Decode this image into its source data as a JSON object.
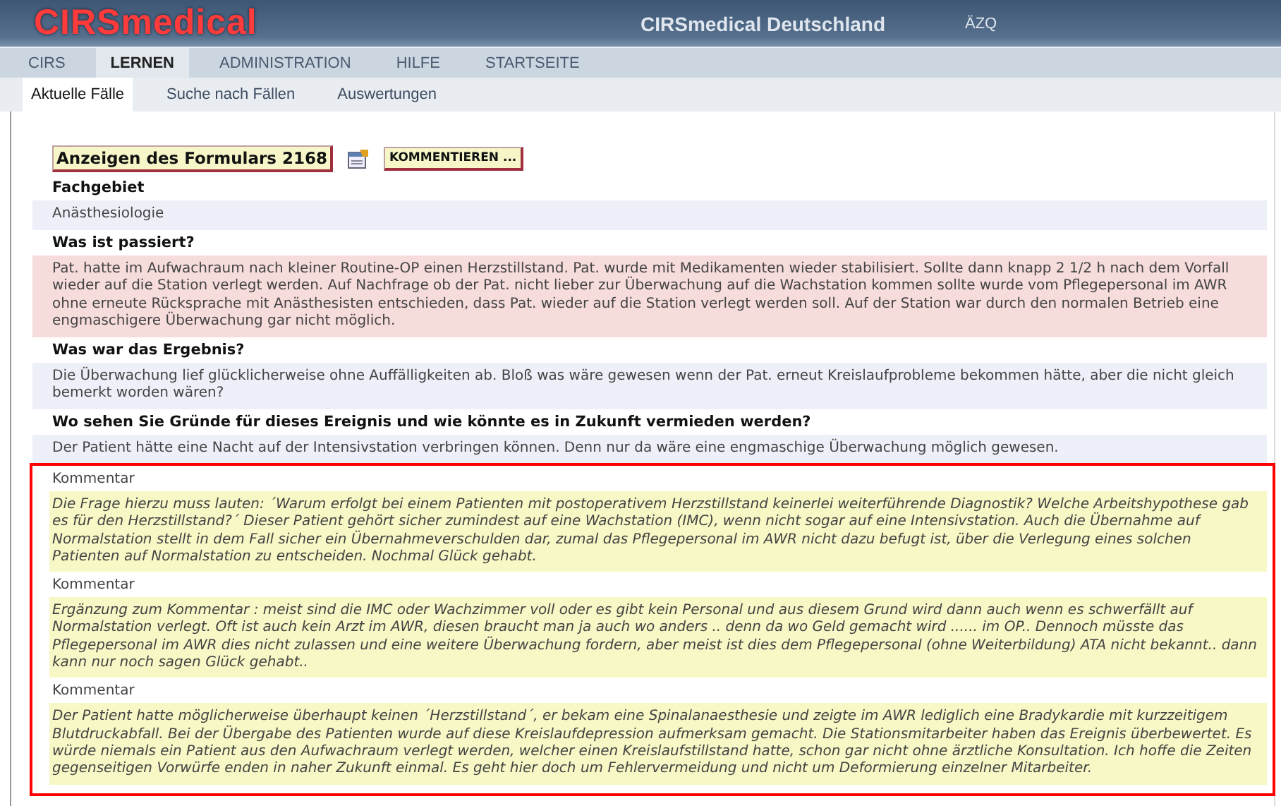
{
  "header": {
    "logo": "CIRSmedical",
    "title": "CIRSmedical Deutschland",
    "org": "ÄZQ"
  },
  "nav": [
    {
      "label": "CIRS",
      "selected": false
    },
    {
      "label": "LERNEN",
      "selected": true
    },
    {
      "label": "ADMINISTRATION",
      "selected": false
    },
    {
      "label": "HILFE",
      "selected": false
    },
    {
      "label": "STARTSEITE",
      "selected": false
    }
  ],
  "subnav": [
    {
      "label": "Aktuelle Fälle",
      "selected": true
    },
    {
      "label": "Suche nach Fällen",
      "selected": false
    },
    {
      "label": "Auswertungen",
      "selected": false
    }
  ],
  "form_button": "Anzeigen des Formulars 2168",
  "comment_button": "KOMMENTIEREN ...",
  "sections": [
    {
      "label": "Fachgebiet",
      "value": "Anästhesiologie",
      "flagged": false
    },
    {
      "label": "Was ist passiert?",
      "value": "Pat. hatte im Aufwachraum nach kleiner Routine-OP einen Herzstillstand. Pat. wurde mit Medikamenten wieder stabilisiert. Sollte dann knapp 2 1/2 h nach dem Vorfall wieder auf die Station verlegt werden. Auf Nachfrage ob der Pat. nicht lieber zur Überwachung auf die Wachstation kommen sollte wurde vom Pflegepersonal im AWR ohne erneute Rücksprache mit Anästhesisten entschieden, dass Pat. wieder auf die Station verlegt werden soll. Auf der Station war durch den normalen Betrieb eine engmaschigere Überwachung gar nicht möglich.",
      "flagged": true
    },
    {
      "label": "Was war das Ergebnis?",
      "value": "Die Überwachung lief glücklicherweise ohne Auffälligkeiten ab. Bloß was wäre gewesen wenn der Pat. erneut Kreislaufprobleme bekommen hätte, aber die nicht gleich bemerkt worden wären?",
      "flagged": false
    },
    {
      "label": "Wo sehen Sie Gründe für dieses Ereignis und wie könnte es in Zukunft vermieden werden?",
      "value": "Der Patient hätte eine Nacht auf der Intensivstation verbringen können. Denn nur da wäre eine engmaschige Überwachung möglich gewesen.",
      "flagged": false
    }
  ],
  "comments_highlighted": true,
  "comments": [
    {
      "label": "Kommentar",
      "text": "Die Frage hierzu muss lauten: ´Warum erfolgt bei einem Patienten mit postoperativem Herzstillstand keinerlei weiterführende Diagnostik? Welche Arbeitshypothese gab es für den Herzstillstand?´ Dieser Patient gehört sicher zumindest auf eine Wachstation (IMC), wenn nicht sogar auf eine Intensivstation. Auch die Übernahme auf Normalstation stellt in dem Fall sicher ein Übernahmeverschulden dar, zumal das Pflegepersonal im AWR nicht dazu befugt ist, über die Verlegung eines solchen Patienten auf Normalstation zu entscheiden. Nochmal Glück gehabt."
    },
    {
      "label": "Kommentar",
      "text": "Ergänzung zum Kommentar : meist sind die IMC oder Wachzimmer voll oder es gibt kein Personal und aus diesem Grund wird dann auch wenn es schwerfällt auf Normalstation verlegt. Oft ist auch kein Arzt im AWR, diesen braucht man ja auch wo anders .. denn da wo Geld gemacht wird ...... im OP.. Dennoch müsste das Pflegepersonal im AWR dies nicht zulassen und eine weitere Überwachung fordern, aber meist ist dies dem Pflegepersonal (ohne Weiterbildung) ATA nicht bekannt.. dann kann nur noch sagen Glück gehabt.."
    },
    {
      "label": "Kommentar",
      "text": "Der Patient hatte möglicherweise überhaupt keinen ´Herzstillstand´, er bekam eine Spinalanaesthesie und zeigte im AWR lediglich eine Bradykardie mit kurzzeitigem Blutdruckabfall. Bei der Übergabe des Patienten wurde auf diese Kreislaufdepression aufmerksam gemacht. Die Stationsmitarbeiter haben das Ereignis überbewertet. Es würde niemals ein Patient aus den Aufwachraum verlegt werden, welcher einen Kreislaufstillstand hatte, schon gar nicht ohne ärztliche Konsultation. Ich hoffe die Zeiten gegenseitigen Vorwürfe enden in naher Zukunft einmal. Es geht hier doch um Fehlervermeidung und nicht um Deformierung einzelner Mitarbeiter."
    }
  ]
}
